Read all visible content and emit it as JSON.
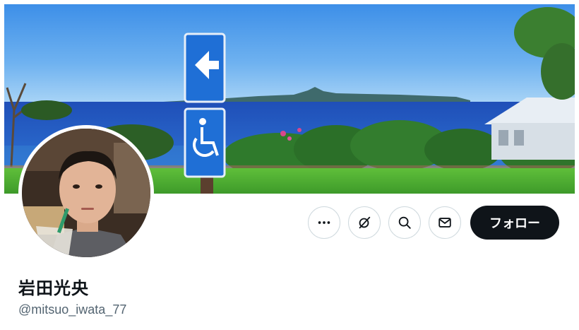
{
  "profile": {
    "display_name": "岩田光央",
    "handle": "@mitsuo_iwata_77"
  },
  "actions": {
    "more_icon": "ellipsis-icon",
    "grok_icon": "grok-slash-circle-icon",
    "search_icon": "search-icon",
    "message_icon": "envelope-icon",
    "follow_label": "フォロー"
  },
  "colors": {
    "follow_button_bg": "#0f1419",
    "follow_button_text": "#ffffff",
    "handle_text": "#536471",
    "button_border": "#cfd9de"
  }
}
